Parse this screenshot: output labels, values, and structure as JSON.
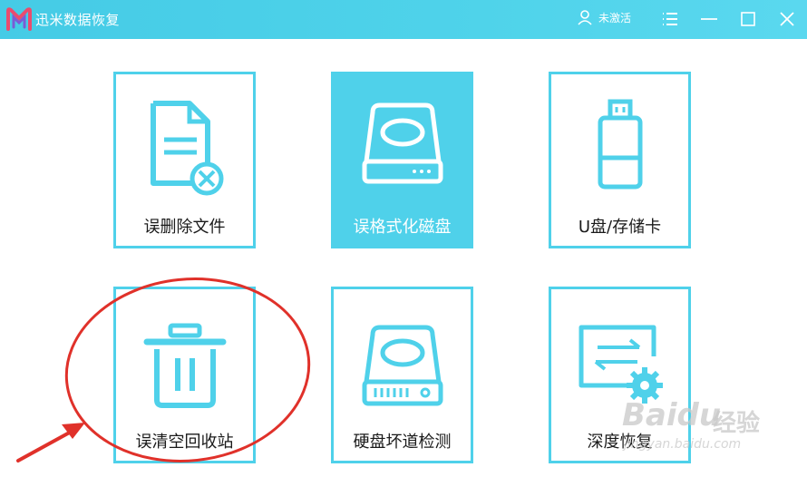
{
  "app": {
    "title": "迅米数据恢复"
  },
  "header": {
    "user_label": "未激活"
  },
  "cards": [
    {
      "label": "误删除文件",
      "icon": "deleted-file-icon"
    },
    {
      "label": "误格式化磁盘",
      "icon": "formatted-disk-icon",
      "selected": true
    },
    {
      "label": "U盘/存储卡",
      "icon": "usb-drive-icon"
    },
    {
      "label": "误清空回收站",
      "icon": "recycle-bin-icon"
    },
    {
      "label": "硬盘坏道检测",
      "icon": "hard-disk-icon"
    },
    {
      "label": "深度恢复",
      "icon": "deep-recovery-icon"
    }
  ],
  "watermark": {
    "brand": "Baidu",
    "brand_cn": "经验",
    "url": "jingyan.baidu.com"
  },
  "colors": {
    "accent": "#4fd1ea",
    "annotation": "#e0312a"
  }
}
